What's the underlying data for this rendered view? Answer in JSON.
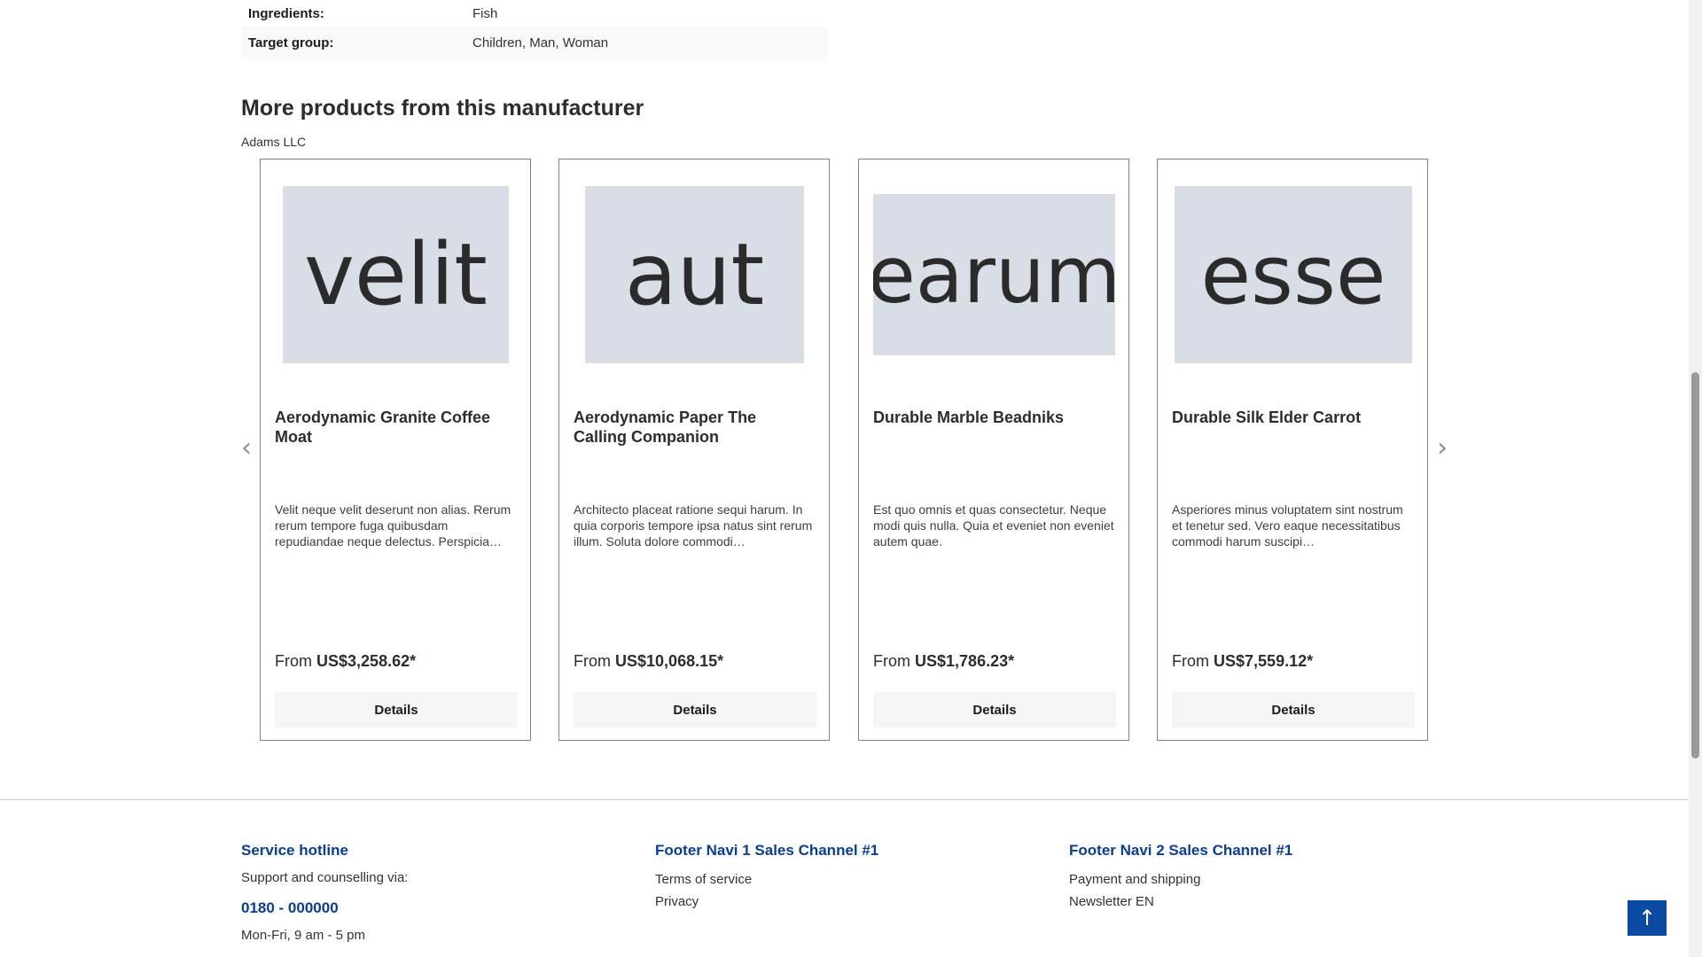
{
  "properties": [
    {
      "label": "Ingredients:",
      "value": "Fish"
    },
    {
      "label": "Target group:",
      "value": "Children, Man, Woman"
    }
  ],
  "section": {
    "title": "More products from this manufacturer",
    "manufacturer": "Adams LLC"
  },
  "products": [
    {
      "image_text": "velit",
      "name": "Aerodynamic Granite Coffee Moat",
      "description": "Velit neque velit deserunt non alias. Rerum rerum tempore fuga quibusdam repudiandae neque delectus. Perspicia…",
      "price_prefix": "From",
      "price": "US$3,258.62*",
      "button": "Details"
    },
    {
      "image_text": "aut",
      "name": "Aerodynamic Paper The Calling Companion",
      "description": "Architecto placeat ratione sequi harum. In quia corporis tempore ipsa natus sint rerum illum. Soluta dolore commodi…",
      "price_prefix": "From",
      "price": "US$10,068.15*",
      "button": "Details"
    },
    {
      "image_text": "earum",
      "name": "Durable Marble Beadniks",
      "description": "Est quo omnis et quas consectetur. Neque modi quis nulla. Quia et eveniet non eveniet autem quae.",
      "price_prefix": "From",
      "price": "US$1,786.23*",
      "button": "Details"
    },
    {
      "image_text": "esse",
      "name": "Durable Silk Elder Carrot",
      "description": "Asperiores minus voluptatem sint nostrum et tenetur sed. Vero eaque necessitatibus commodi harum suscipi…",
      "price_prefix": "From",
      "price": "US$7,559.12*",
      "button": "Details"
    }
  ],
  "slider": {
    "prev_icon": "chevron-left-icon",
    "next_icon": "chevron-right-icon"
  },
  "footer": {
    "service": {
      "heading": "Service hotline",
      "text": "Support and counselling via:",
      "phone": "0180 - 000000",
      "hours": "Mon-Fri, 9 am - 5 pm"
    },
    "navi1": {
      "heading": "Footer Navi 1 Sales Channel #1",
      "links": [
        "Terms of service",
        "Privacy"
      ]
    },
    "navi2": {
      "heading": "Footer Navi 2 Sales Channel #1",
      "links": [
        "Payment and shipping",
        "Newsletter EN"
      ]
    }
  },
  "scroll_top_icon": "arrow-up-icon",
  "colors": {
    "accent": "#0b4aa2",
    "heading_link": "#0b3d91",
    "image_placeholder": "#d9dde5"
  }
}
